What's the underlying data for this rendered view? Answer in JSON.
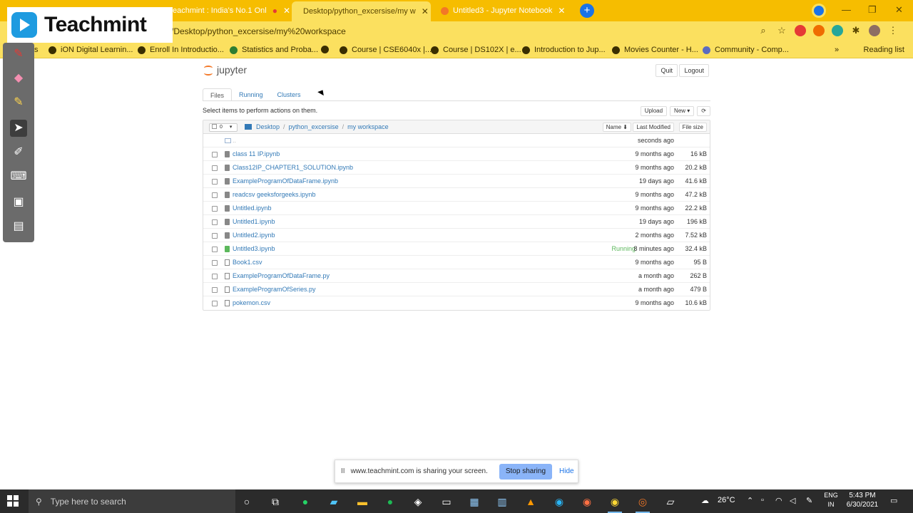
{
  "browser": {
    "tabs": [
      {
        "title": "eachmint : India's No.1 Onl",
        "active": false
      },
      {
        "title": "Desktop/python_excersise/my w",
        "active": true
      },
      {
        "title": "Untitled3 - Jupyter Notebook",
        "active": false
      }
    ],
    "url": "/Desktop/python_excersise/my%20workspace",
    "bookmarks": [
      "iON Digital Learnin...",
      "Enroll In Introductio...",
      "Statistics and Proba...",
      "Course | CSE6040x |...",
      "Course | DS102X | e...",
      "Introduction to Jup...",
      "Movies Counter - H...",
      "Community - Comp..."
    ],
    "reading_list": "Reading list",
    "bookmark_prefix": "s"
  },
  "overlay": {
    "brand": "Teachmint"
  },
  "jupyter": {
    "logo": "jupyter",
    "quit": "Quit",
    "logout": "Logout",
    "tabs": [
      "Files",
      "Running",
      "Clusters"
    ],
    "hint": "Select items to perform actions on them.",
    "upload": "Upload",
    "new": "New ▾",
    "refresh": "⟳",
    "selected_count": "0",
    "breadcrumb": [
      "Desktop",
      "python_excersise",
      "my workspace"
    ],
    "sort": {
      "name": "Name ⬇",
      "modified": "Last Modified",
      "size": "File size"
    },
    "parent_dir": {
      "name": "..",
      "modified": "seconds ago"
    },
    "files": [
      {
        "name": "class 11 IP.ipynb",
        "modified": "9 months ago",
        "size": "16 kB",
        "kind": "nb",
        "running": ""
      },
      {
        "name": "Class12IP_CHAPTER1_SOLUTION.ipynb",
        "modified": "9 months ago",
        "size": "20.2 kB",
        "kind": "nb",
        "running": ""
      },
      {
        "name": "ExampleProgramOfDataFrame.ipynb",
        "modified": "19 days ago",
        "size": "41.6 kB",
        "kind": "nb",
        "running": ""
      },
      {
        "name": "readcsv geeksforgeeks.ipynb",
        "modified": "9 months ago",
        "size": "47.2 kB",
        "kind": "nb",
        "running": ""
      },
      {
        "name": "Untitled.ipynb",
        "modified": "9 months ago",
        "size": "22.2 kB",
        "kind": "nb",
        "running": ""
      },
      {
        "name": "Untitled1.ipynb",
        "modified": "19 days ago",
        "size": "196 kB",
        "kind": "nb",
        "running": ""
      },
      {
        "name": "Untitled2.ipynb",
        "modified": "2 months ago",
        "size": "7.52 kB",
        "kind": "nb",
        "running": ""
      },
      {
        "name": "Untitled3.ipynb",
        "modified": "8 minutes ago",
        "size": "32.4 kB",
        "kind": "nb",
        "running": "Running"
      },
      {
        "name": "Book1.csv",
        "modified": "9 months ago",
        "size": "95 B",
        "kind": "file",
        "running": ""
      },
      {
        "name": "ExampleProgramOfDataFrame.py",
        "modified": "a month ago",
        "size": "262 B",
        "kind": "file",
        "running": ""
      },
      {
        "name": "ExampleProgramOfSeries.py",
        "modified": "a month ago",
        "size": "479 B",
        "kind": "file",
        "running": ""
      },
      {
        "name": "pokemon.csv",
        "modified": "9 months ago",
        "size": "10.6 kB",
        "kind": "file",
        "running": ""
      }
    ]
  },
  "share": {
    "pause": "II",
    "message": "www.teachmint.com is sharing your screen.",
    "stop": "Stop sharing",
    "hide": "Hide"
  },
  "taskbar": {
    "search_placeholder": "Type here to search",
    "weather": "26°C",
    "lang_top": "ENG",
    "lang_bottom": "IN",
    "time": "5:43 PM",
    "date": "6/30/2021"
  },
  "colors": {
    "chrome_yellow": "#f6bd00",
    "jupyter_link": "#337ab7",
    "running_green": "#5cb85c",
    "share_button": "#8ab4f8"
  }
}
